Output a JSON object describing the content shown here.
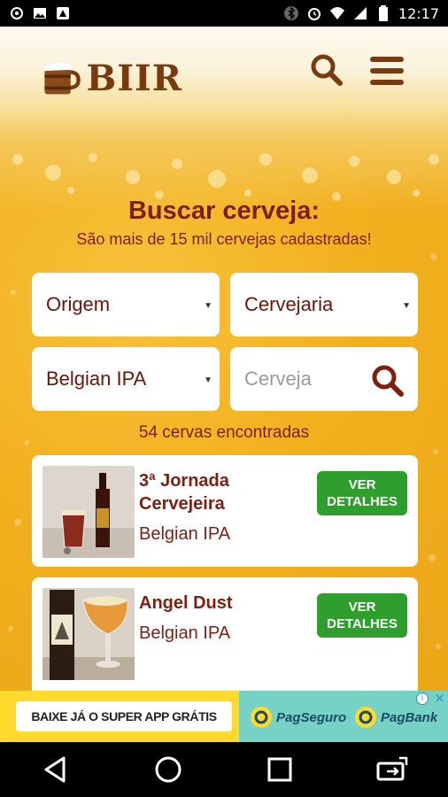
{
  "status_bar": {
    "time": "12:17",
    "left_icons": [
      "photo-icon",
      "gallery-icon",
      "app-notification-icon"
    ],
    "right_icons": [
      "bluetooth-icon",
      "alarm-icon",
      "wifi-icon",
      "signal-icon",
      "battery-icon"
    ]
  },
  "header": {
    "logo_text": "BIIR",
    "search_icon": "search-icon",
    "menu_icon": "hamburger-menu-icon",
    "brand_color": "#7a3a10"
  },
  "search": {
    "title": "Buscar cerveja:",
    "subtitle": "São mais de 15 mil cervejas cadastradas!",
    "origem_label": "Origem",
    "cervejaria_label": "Cervejaria",
    "estilo_value": "Belgian IPA",
    "cerveja_placeholder": "Cerveja"
  },
  "results": {
    "count_text": "54 cervas encontradas",
    "items": [
      {
        "name": "3ª Jornada Cervejeira",
        "style": "Belgian IPA",
        "button_label": "VER DETALHES"
      },
      {
        "name": "Angel Dust",
        "style": "Belgian IPA",
        "button_label": "VER DETALHES"
      }
    ]
  },
  "ad": {
    "cta": "BAIXE JÁ O SUPER APP GRÁTIS",
    "brand_1": "PagSeguro",
    "brand_2": "PagBank",
    "info_glyph": "i",
    "close_glyph": "✕"
  },
  "nav": {
    "icons": [
      "back-icon",
      "home-icon",
      "recents-icon",
      "rotate-icon"
    ]
  },
  "colors": {
    "accent_text": "#7e1f10",
    "button_green": "#2e9e2c",
    "beer": "#f2b01e"
  }
}
